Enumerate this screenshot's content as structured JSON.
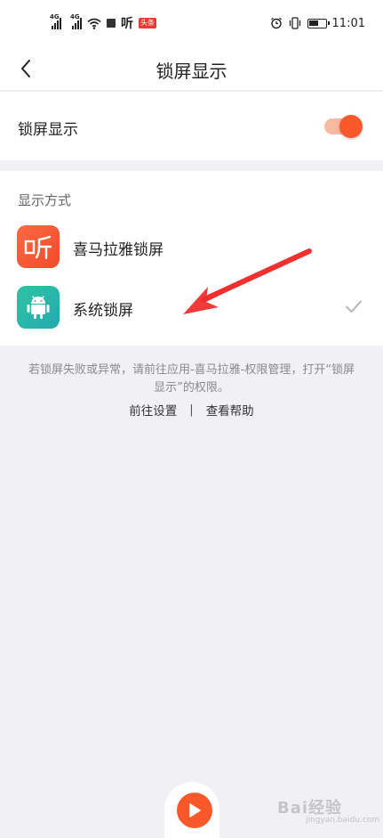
{
  "status_bar": {
    "network_1": "4G",
    "network_2": "4G",
    "app_glyph": "听",
    "app_badge": "头条",
    "time": "11:01",
    "icons": [
      "signal-icon",
      "signal-icon",
      "wifi-icon",
      "notification-square-icon",
      "alarm-icon",
      "vibrate-icon",
      "battery-icon"
    ]
  },
  "nav": {
    "title": "锁屏显示",
    "back_icon": "chevron-left-icon"
  },
  "toggle": {
    "label": "锁屏显示",
    "on": true,
    "accent": "#f8582a"
  },
  "display_mode": {
    "section_title": "显示方式",
    "options": [
      {
        "label": "喜马拉雅锁屏",
        "icon": "ximalaya-logo-icon",
        "icon_glyph": "听",
        "selected": false
      },
      {
        "label": "系统锁屏",
        "icon": "android-robot-icon",
        "selected": true
      }
    ]
  },
  "footer": {
    "hint": "若锁屏失败或异常，请前往应用-喜马拉雅-权限管理，打开“锁屏显示”的权限。",
    "link_settings": "前往设置",
    "separator": "|",
    "link_help": "查看帮助"
  },
  "watermark": {
    "text": "Bai经验",
    "sub": "jingyan.baidu.com"
  },
  "colors": {
    "accent": "#f8582a",
    "background": "#f1f0f4",
    "annotation_arrow": "#f0302e"
  }
}
